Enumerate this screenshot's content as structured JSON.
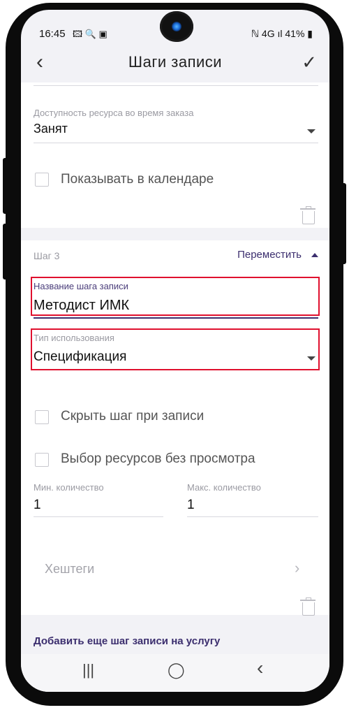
{
  "status": {
    "time": "16:45",
    "left_icons": "🖾 🔍 ▣",
    "right": "ℕ 4G ıl 41% ▮"
  },
  "header": {
    "title": "Шаги записи",
    "back_icon": "back-arrow",
    "confirm_icon": "check-icon"
  },
  "step2": {
    "availability_label": "Доступность ресурса во время заказа",
    "availability_value": "Занят",
    "show_in_calendar": "Показывать в календаре"
  },
  "step3": {
    "title": "Шаг 3",
    "move_label": "Переместить",
    "name_label": "Название шага записи",
    "name_value": "Методист ИМК",
    "usage_label": "Тип использования",
    "usage_value": "Спецификация",
    "hide_step": "Скрыть шаг при записи",
    "select_without_view": "Выбор ресурсов без просмотра",
    "min_label": "Мин. количество",
    "min_value": "1",
    "max_label": "Макс. количество",
    "max_value": "1",
    "hashtags": "Хештеги"
  },
  "footer": {
    "add_step": "Добавить еще шаг записи на услугу"
  },
  "nav": {
    "recent": "|||",
    "home": "◯",
    "back": "‹"
  },
  "colors": {
    "accent": "#3b2e6e",
    "highlight": "#e0102e"
  }
}
